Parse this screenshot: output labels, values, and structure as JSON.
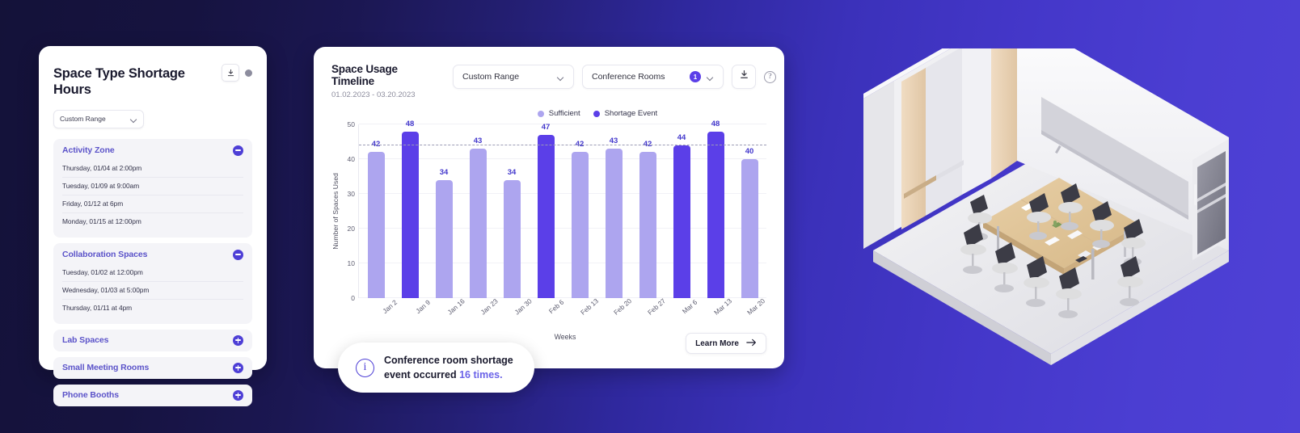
{
  "left_card": {
    "title": "Space Type Shortage Hours",
    "download_icon": "download-icon",
    "settings_icon": "settings-dot-icon",
    "range_select": {
      "value": "Custom Range",
      "chevron": "chevron-down-icon"
    },
    "groups": [
      {
        "name": "Activity Zone",
        "expanded": true,
        "toggle_icon": "minus-circle-icon",
        "items": [
          "Thursday, 01/04 at 2:00pm",
          "Tuesday, 01/09 at 9:00am",
          "Friday, 01/12 at 6pm",
          "Monday, 01/15 at 12:00pm"
        ]
      },
      {
        "name": "Collaboration Spaces",
        "expanded": true,
        "toggle_icon": "minus-circle-icon",
        "items": [
          "Tuesday, 01/02 at 12:00pm",
          "Wednesday, 01/03 at 5:00pm",
          "Thursday, 01/11 at 4pm"
        ]
      },
      {
        "name": "Lab Spaces",
        "expanded": false,
        "toggle_icon": "plus-circle-icon",
        "items": []
      },
      {
        "name": "Small Meeting Rooms",
        "expanded": false,
        "toggle_icon": "plus-circle-icon",
        "items": []
      },
      {
        "name": "Phone Booths",
        "expanded": false,
        "toggle_icon": "plus-circle-icon",
        "items": []
      }
    ]
  },
  "center_card": {
    "title": "Space Usage Timeline",
    "date_range": "01.02.2023 - 03.20.2023",
    "range_select": {
      "value": "Custom Range",
      "chevron": "chevron-down-icon"
    },
    "rooms_select": {
      "value": "Conference Rooms",
      "badge": "1",
      "chevron": "chevron-down-icon"
    },
    "download_icon": "download-icon",
    "help_icon": "help-circle-icon",
    "learn_more": {
      "label": "Learn More",
      "icon": "arrow-right-icon"
    }
  },
  "toast": {
    "icon": "info-circle-icon",
    "line1": "Conference room shortage",
    "line2_prefix": "event occurred ",
    "line2_highlight": "16 times."
  },
  "colors": {
    "sufficient": "#ada5ef",
    "shortage": "#5b3fe8",
    "accent": "#4e3fd6",
    "label": "#4338cc"
  },
  "chart_data": {
    "type": "bar",
    "title": "Space Usage Timeline",
    "xlabel": "Weeks",
    "ylabel": "Number of Spaces Used",
    "ylim": [
      0,
      50
    ],
    "yticks": [
      0,
      10,
      20,
      30,
      40,
      50
    ],
    "grid": true,
    "threshold": 44,
    "legend_position": "top-right",
    "legend": [
      {
        "name": "Sufficient",
        "color": "#ada5ef"
      },
      {
        "name": "Shortage Event",
        "color": "#5b3fe8"
      }
    ],
    "categories": [
      "Jan 2",
      "Jan 9",
      "Jan 16",
      "Jan 23",
      "Jan 30",
      "Feb 6",
      "Feb 13",
      "Feb 20",
      "Feb 27",
      "Mar 6",
      "Mar 13",
      "Mar 20"
    ],
    "values": [
      42,
      48,
      34,
      43,
      34,
      47,
      42,
      43,
      42,
      44,
      48,
      40
    ],
    "states": [
      "sufficient",
      "shortage",
      "sufficient",
      "sufficient",
      "sufficient",
      "shortage",
      "sufficient",
      "sufficient",
      "sufficient",
      "shortage",
      "shortage",
      "sufficient"
    ]
  }
}
